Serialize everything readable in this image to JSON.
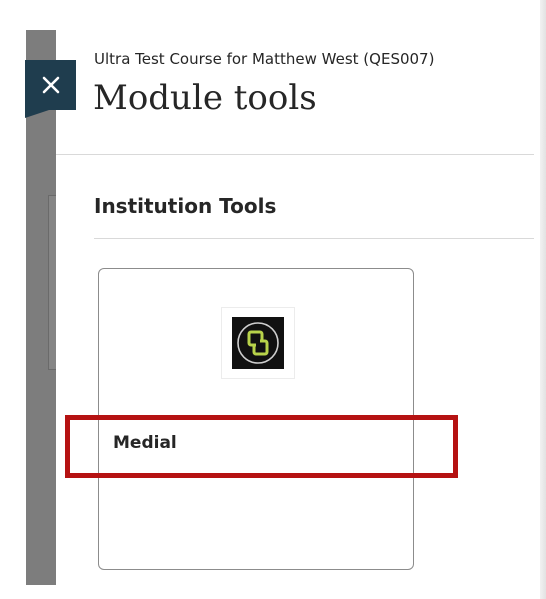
{
  "header": {
    "course_name": "Ultra Test Course for Matthew West (QES007)",
    "title": "Module tools"
  },
  "close_button": {
    "icon": "close-icon",
    "glyph": "✕"
  },
  "sections": [
    {
      "title": "Institution Tools",
      "tools": [
        {
          "name": "Medial",
          "logo_icon": "medial-logo-icon",
          "highlighted": true
        }
      ]
    }
  ],
  "colors": {
    "close_button_bg": "#1f3d4e",
    "highlight": "#b51212",
    "logo_bg": "#111111",
    "logo_accent": "#b8d34a"
  }
}
